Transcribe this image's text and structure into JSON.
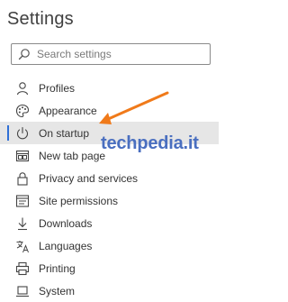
{
  "header": {
    "title": "Settings"
  },
  "search": {
    "placeholder": "Search settings",
    "icon": "search-icon"
  },
  "sidebar": {
    "selected_index": 2,
    "accent_color": "#2f6fd6",
    "items": [
      {
        "label": "Profiles",
        "icon": "person-icon"
      },
      {
        "label": "Appearance",
        "icon": "palette-icon"
      },
      {
        "label": "On startup",
        "icon": "power-icon"
      },
      {
        "label": "New tab page",
        "icon": "new-tab-icon"
      },
      {
        "label": "Privacy and services",
        "icon": "lock-icon"
      },
      {
        "label": "Site permissions",
        "icon": "site-permissions-icon"
      },
      {
        "label": "Downloads",
        "icon": "download-icon"
      },
      {
        "label": "Languages",
        "icon": "languages-icon"
      },
      {
        "label": "Printing",
        "icon": "printer-icon"
      },
      {
        "label": "System",
        "icon": "laptop-icon"
      }
    ]
  },
  "watermark": {
    "text": "techpedia.it",
    "color": "#4a6fc0"
  },
  "annotation": {
    "arrow_color": "#f07a1a"
  }
}
